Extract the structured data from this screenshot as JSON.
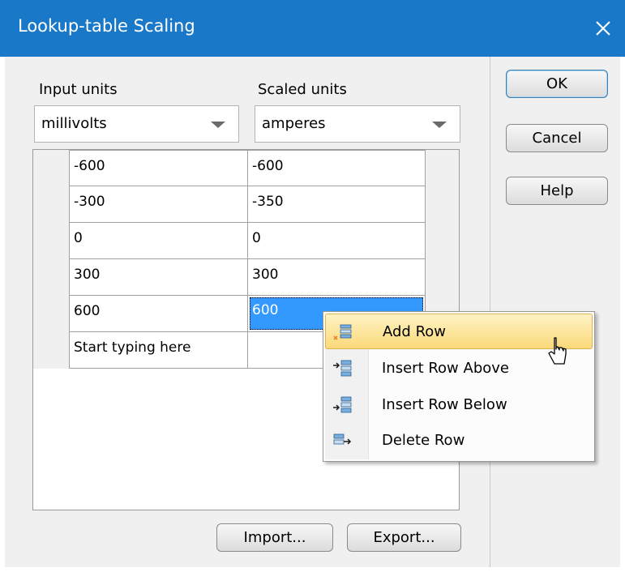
{
  "window": {
    "title": "Lookup-table Scaling",
    "close_icon": "close-icon"
  },
  "input_units": {
    "label": "Input units",
    "value": "millivolts"
  },
  "scaled_units": {
    "label": "Scaled units",
    "value": "amperes"
  },
  "table": {
    "rows": [
      {
        "input": "-600",
        "scaled": "-600"
      },
      {
        "input": "-300",
        "scaled": "-350"
      },
      {
        "input": "0",
        "scaled": "0"
      },
      {
        "input": "300",
        "scaled": "300"
      },
      {
        "input": "600",
        "scaled": "600"
      }
    ],
    "new_row_placeholder": "Start typing here",
    "selected_cell": {
      "row": 5,
      "column": "scaled"
    }
  },
  "buttons": {
    "ok": "OK",
    "cancel": "Cancel",
    "help": "Help",
    "import": "Import...",
    "export": "Export..."
  },
  "context_menu": {
    "items": [
      {
        "label": "Add Row",
        "icon": "add-row-icon",
        "highlighted": true
      },
      {
        "label": "Insert Row Above",
        "icon": "insert-row-above-icon",
        "highlighted": false
      },
      {
        "label": "Insert Row Below",
        "icon": "insert-row-below-icon",
        "highlighted": false
      },
      {
        "label": "Delete Row",
        "icon": "delete-row-icon",
        "highlighted": false
      }
    ]
  },
  "colors": {
    "titlebar": "#1a78c8",
    "selection": "#3399ff",
    "menu_highlight": "#fbd97a"
  }
}
